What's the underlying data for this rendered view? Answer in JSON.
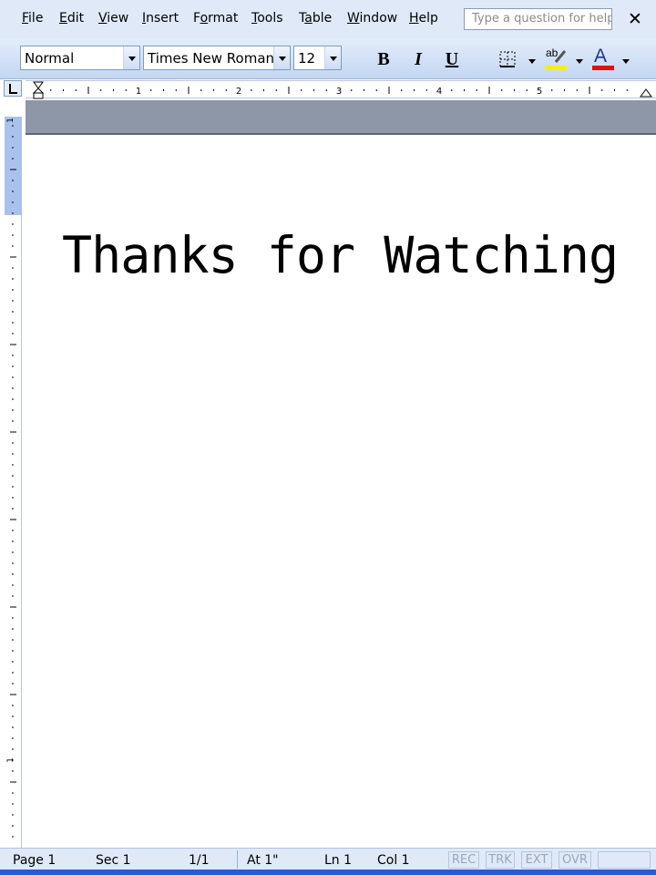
{
  "menu": {
    "file": {
      "u": "F",
      "rest": "ile"
    },
    "edit": {
      "u": "E",
      "rest": "dit"
    },
    "view": {
      "u": "V",
      "rest": "iew"
    },
    "insert": {
      "u": "I",
      "rest": "nsert"
    },
    "format": {
      "pre": "F",
      "u": "o",
      "rest": "rmat"
    },
    "tools": {
      "u": "T",
      "rest": "ools"
    },
    "table": {
      "pre": "T",
      "u": "a",
      "rest": "ble"
    },
    "window": {
      "u": "W",
      "rest": "indow"
    },
    "help": {
      "u": "H",
      "rest": "elp"
    }
  },
  "help_search": {
    "placeholder": "Type a question for help"
  },
  "close_glyph": "✕",
  "toolbar": {
    "style_value": "Normal",
    "font_value": "Times New Roman",
    "size_value": "12",
    "bold_label": "B",
    "italic_label": "I",
    "underline_label": "U",
    "highlight_label": "ab",
    "font_color_label": "A",
    "highlight_color": "#f6f000",
    "font_color": "#e01010"
  },
  "ruler": {
    "h_numbers": [
      "1",
      "2",
      "3",
      "4",
      "5"
    ],
    "v_numbers": [
      "1",
      "1"
    ]
  },
  "document": {
    "text": "Thanks for Watching"
  },
  "status": {
    "page": "Page  1",
    "sec": "Sec  1",
    "pages": "1/1",
    "at": "At  1\"",
    "ln": "Ln  1",
    "col": "Col  1",
    "rec": "REC",
    "trk": "TRK",
    "ext": "EXT",
    "ovr": "OVR"
  }
}
